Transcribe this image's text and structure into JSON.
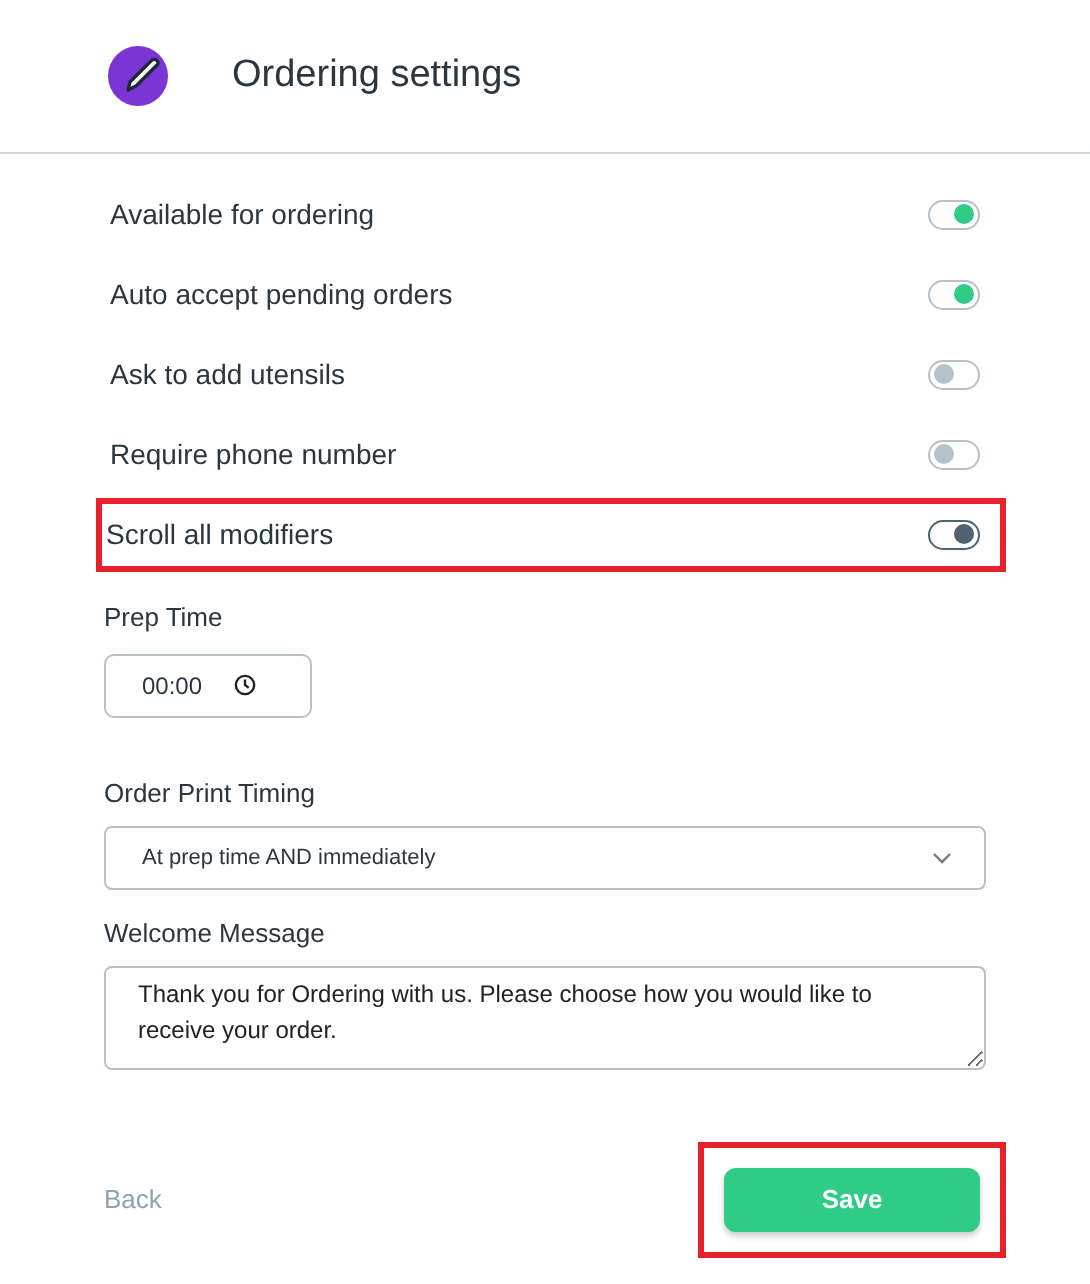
{
  "header": {
    "title": "Ordering settings"
  },
  "toggles": [
    {
      "label": "Available for ordering",
      "on": true,
      "highlighted": false
    },
    {
      "label": "Auto accept pending orders",
      "on": true,
      "highlighted": false
    },
    {
      "label": "Ask to add utensils",
      "on": false,
      "highlighted": false
    },
    {
      "label": "Require phone number",
      "on": false,
      "highlighted": false
    },
    {
      "label": "Scroll all modifiers",
      "on": true,
      "highlighted": true
    }
  ],
  "prep_time": {
    "label": "Prep Time",
    "value": "00:00"
  },
  "print_timing": {
    "label": "Order Print Timing",
    "value": "At prep time AND immediately"
  },
  "welcome": {
    "label": "Welcome Message",
    "value": "Thank you for Ordering with us. Please choose how you would like to receive your order."
  },
  "footer": {
    "back": "Back",
    "save": "Save",
    "save_highlighted": true
  }
}
